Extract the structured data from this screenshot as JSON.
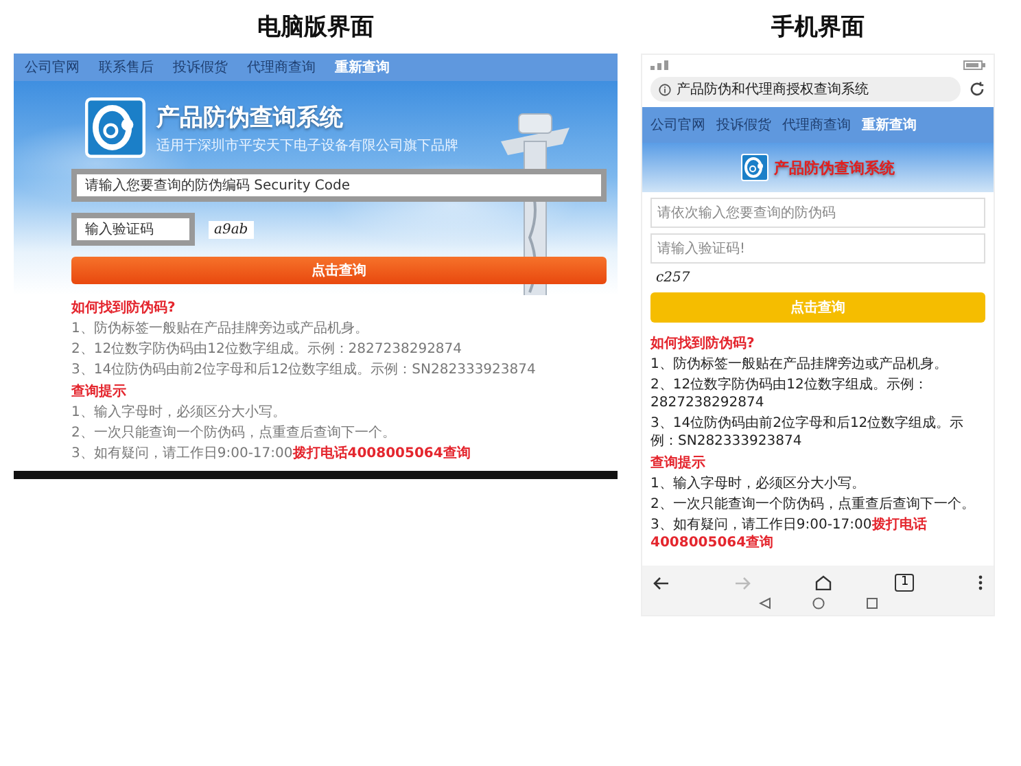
{
  "headings": {
    "desktop": "电脑版界面",
    "mobile": "手机界面"
  },
  "desktop": {
    "nav": [
      {
        "label": "公司官网",
        "selected": false
      },
      {
        "label": "联系售后",
        "selected": false
      },
      {
        "label": "投诉假货",
        "selected": false
      },
      {
        "label": "代理商查询",
        "selected": false
      },
      {
        "label": "重新查询",
        "selected": true
      }
    ],
    "title": "产品防伪查询系统",
    "subtitle": "适用于深圳市平安天下电子设备有限公司旗下品牌",
    "code_field": {
      "placeholder": "请输入您要查询的防伪编码 Security Code"
    },
    "captcha_field": {
      "placeholder": "输入验证码"
    },
    "captcha": "a9ab",
    "submit": "点击查询",
    "sections": [
      {
        "title": "如何找到防伪码?",
        "items": [
          {
            "text": "1、防伪标签一般贴在产品挂牌旁边或产品机身。"
          },
          {
            "text": "2、12位数字防伪码由12位数字组成。示例：2827238292874"
          },
          {
            "text": "3、14位防伪码由前2位字母和后12位数字组成。示例：SN282333923874"
          }
        ]
      },
      {
        "title": "查询提示",
        "items": [
          {
            "text": "1、输入字母时，必须区分大小写。"
          },
          {
            "text": "2、一次只能查询一个防伪码，点重查后查询下一个。"
          },
          {
            "text": "3、如有疑问，请工作日9:00-17:00",
            "highlight": "拨打电话4008005064查询"
          }
        ]
      }
    ]
  },
  "mobile": {
    "address": "产品防伪和代理商授权查询系统",
    "nav": [
      {
        "label": "公司官网",
        "selected": false
      },
      {
        "label": "投诉假货",
        "selected": false
      },
      {
        "label": "代理商查询",
        "selected": false
      },
      {
        "label": "重新查询",
        "selected": true
      }
    ],
    "title": "产品防伪查询系统",
    "code_field": {
      "placeholder": "请依次输入您要查询的防伪码"
    },
    "captcha_field": {
      "placeholder": "请输入验证码!"
    },
    "captcha": "c257",
    "submit": "点击查询",
    "sections": [
      {
        "title": "如何找到防伪码?",
        "items": [
          {
            "text": "1、防伪标签一般贴在产品挂牌旁边或产品机身。"
          },
          {
            "text": "2、12位数字防伪码由12位数字组成。示例：2827238292874"
          },
          {
            "text": "3、14位防伪码由前2位字母和后12位数字组成。示例：SN282333923874"
          }
        ]
      },
      {
        "title": "查询提示",
        "items": [
          {
            "text": "1、输入字母时，必须区分大小写。"
          },
          {
            "text": "2、一次只能查询一个防伪码，点重查后查询下一个。"
          },
          {
            "text": "3、如有疑问，请工作日9:00-17:00",
            "highlight": "拨打电话4008005064查询"
          }
        ]
      }
    ],
    "tab_count": "1"
  }
}
